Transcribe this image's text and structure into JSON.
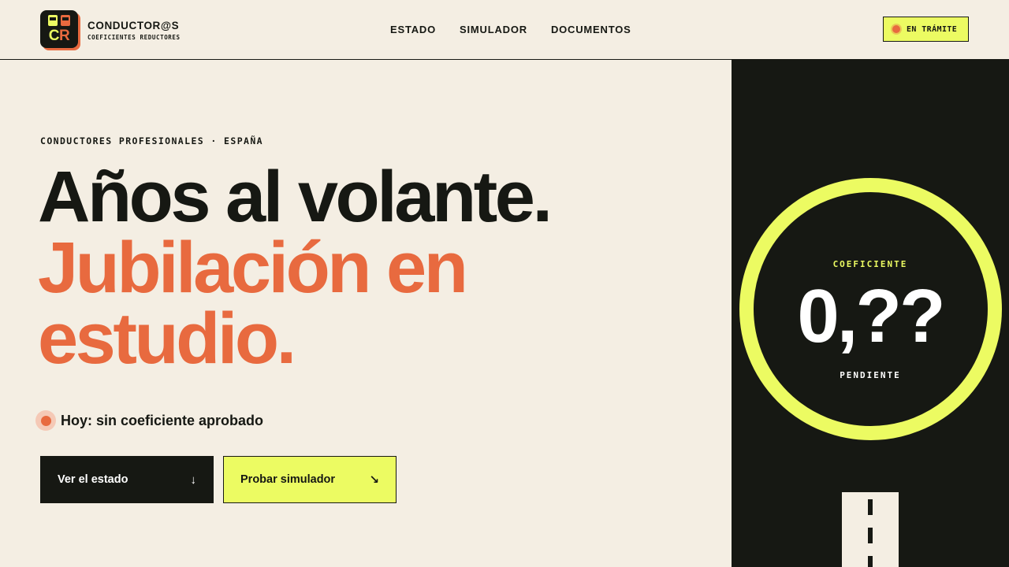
{
  "brand": {
    "name": "CONDUCTOR@S",
    "subtitle": "COEFICIENTES REDUCTORES",
    "logo_text_c": "C",
    "logo_text_r": "R"
  },
  "nav": {
    "items": [
      {
        "label": "ESTADO"
      },
      {
        "label": "SIMULADOR"
      },
      {
        "label": "DOCUMENTOS"
      }
    ]
  },
  "status_chip": {
    "label": "EN TRÁMITE"
  },
  "hero": {
    "eyebrow": "CONDUCTORES PROFESIONALES · ESPAÑA",
    "headline_line1": "Años al volante.",
    "headline_line2a": "Jubilación en",
    "headline_line2b": "estudio.",
    "today_text": "Hoy: sin coeficiente aprobado"
  },
  "buttons": {
    "primary": {
      "label": "Ver el estado",
      "icon": "arrow-down-icon",
      "glyph": "↓"
    },
    "secondary": {
      "label": "Probar simulador",
      "icon": "arrow-down-right-icon",
      "glyph": "↘"
    }
  },
  "coefficient": {
    "label": "COEFICIENTE",
    "value": "0,??",
    "status": "PENDIENTE"
  },
  "colors": {
    "background": "#f4eee3",
    "dark": "#161813",
    "accent_orange": "#e86a3f",
    "accent_lime": "#ecfb62"
  }
}
